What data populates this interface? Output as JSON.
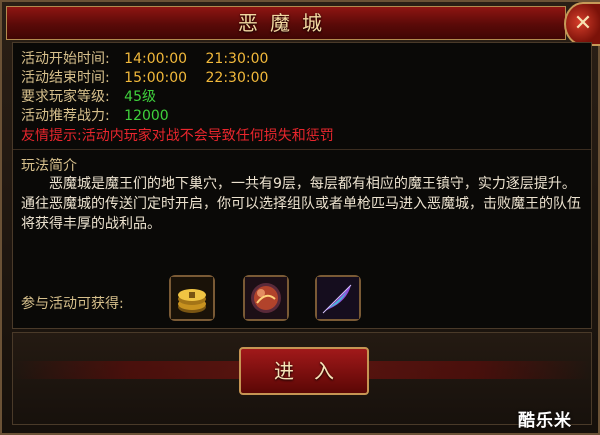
{
  "window": {
    "title": "恶魔城",
    "close_icon": "close-icon"
  },
  "info": {
    "start": {
      "label": "活动开始时间:",
      "values": [
        "14:00:00",
        "21:30:00"
      ]
    },
    "end": {
      "label": "活动结束时间:",
      "values": [
        "15:00:00",
        "22:30:00"
      ]
    },
    "level": {
      "label": "要求玩家等级:",
      "value": "45级"
    },
    "power": {
      "label": "活动推荐战力:",
      "value": "12000"
    },
    "tip": "友情提示:活动内玩家对战不会导致任何损失和惩罚"
  },
  "section": {
    "heading": "玩法简介",
    "description": "恶魔城是魔王们的地下巢穴，一共有9层，每层都有相应的魔王镇守，实力逐层提升。通往恶魔城的传送门定时开启，你可以选择组队或者单枪匹马进入恶魔城，击败魔王的队伍将获得丰厚的战利品。"
  },
  "rewards": {
    "label": "参与活动可获得:",
    "items": [
      "gold-coin-icon",
      "orb-icon",
      "feather-icon"
    ]
  },
  "enter_button": "进入",
  "watermark": "酷乐米",
  "colors": {
    "accent_red": "#8e1512",
    "gold": "#f2b93b",
    "green": "#3fd13c",
    "warning": "#e8262d"
  }
}
